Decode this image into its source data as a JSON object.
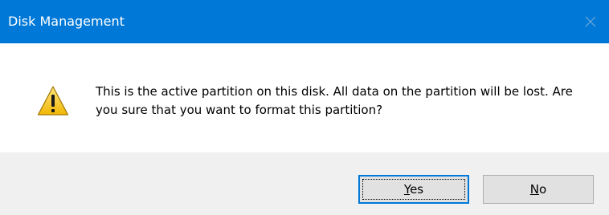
{
  "window": {
    "title": "Disk Management",
    "close_icon": "close-icon",
    "title_bar_color": "#0078d7"
  },
  "dialog": {
    "icon": "warning-icon",
    "message": "This is the active partition on this disk. All data on the partition will be lost. Are you sure that you want to format this partition?"
  },
  "buttons": {
    "yes": {
      "label": "Yes",
      "accelerator": "Y",
      "rest": "es",
      "is_default": true
    },
    "no": {
      "label": "No",
      "accelerator": "N",
      "rest": "o",
      "is_default": false
    }
  },
  "colors": {
    "accent": "#0078d7",
    "warning_yellow": "#fcd116",
    "footer_bg": "#f0f0f0"
  }
}
